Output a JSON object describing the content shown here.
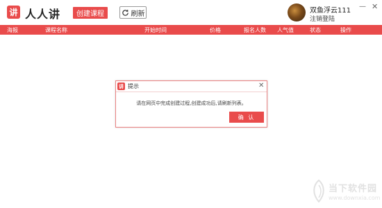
{
  "header": {
    "logo_glyph": "讲",
    "app_name": "人人讲",
    "create_label": "创建课程",
    "refresh_label": "刷新",
    "username": "双鱼浮云111",
    "logout_label": "注销登陆",
    "minimize_glyph": "—",
    "close_glyph": "✕"
  },
  "table": {
    "columns": [
      "海报",
      "课程名称",
      "开始时间",
      "价格",
      "报名人数",
      "人气值",
      "状态",
      "操作"
    ]
  },
  "dialog": {
    "logo_glyph": "讲",
    "title": "提示",
    "close_glyph": "✕",
    "message": "请在网页中完成创建过程,创建成功后,请刷新列表。",
    "ok_label": "确 认"
  },
  "watermark": {
    "name": "当下软件园",
    "url": "www.downxia.com"
  },
  "colors": {
    "accent": "#e94b4b",
    "background": "#ffffff"
  }
}
